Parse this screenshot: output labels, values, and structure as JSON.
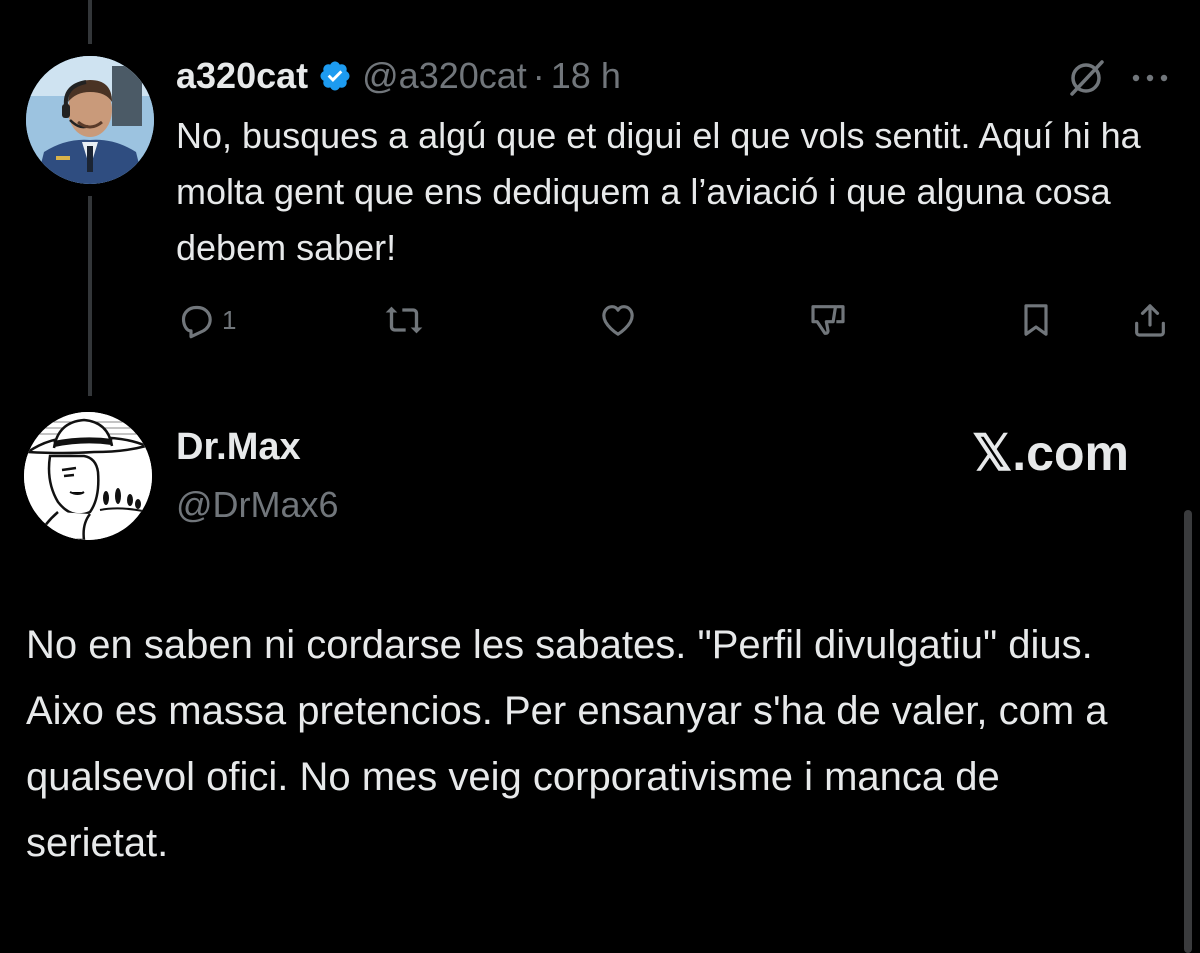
{
  "reply": {
    "display_name": "a320cat",
    "handle": "@a320cat",
    "separator": "·",
    "time": "18 h",
    "verified_icon": "verified-badge-icon",
    "text": "No, busques a algú que et digui el que vols sentit. Aquí hi ha molta gent que ens dediquem a l’aviació i que alguna cosa debem saber!",
    "actions": {
      "reply_count": "1",
      "icons": [
        "reply-icon",
        "retweet-icon",
        "like-icon",
        "dislike-icon",
        "bookmark-icon",
        "share-icon"
      ]
    }
  },
  "quoted": {
    "display_name": "Dr.Max",
    "handle": "@DrMax6",
    "watermark": "𝕏.com",
    "text": "No en saben ni cordarse les sabates. \"Perfil divulgatiu\" dius. Aixo es massa pretencios. Per ensanyar s'ha de valer, com a qualsevol ofici. No mes veig corporativisme i manca de serietat."
  },
  "colors": {
    "background": "#000000",
    "primary_text": "#e7e9ea",
    "secondary_text": "#71767b",
    "verified_blue": "#1d9bf0"
  }
}
